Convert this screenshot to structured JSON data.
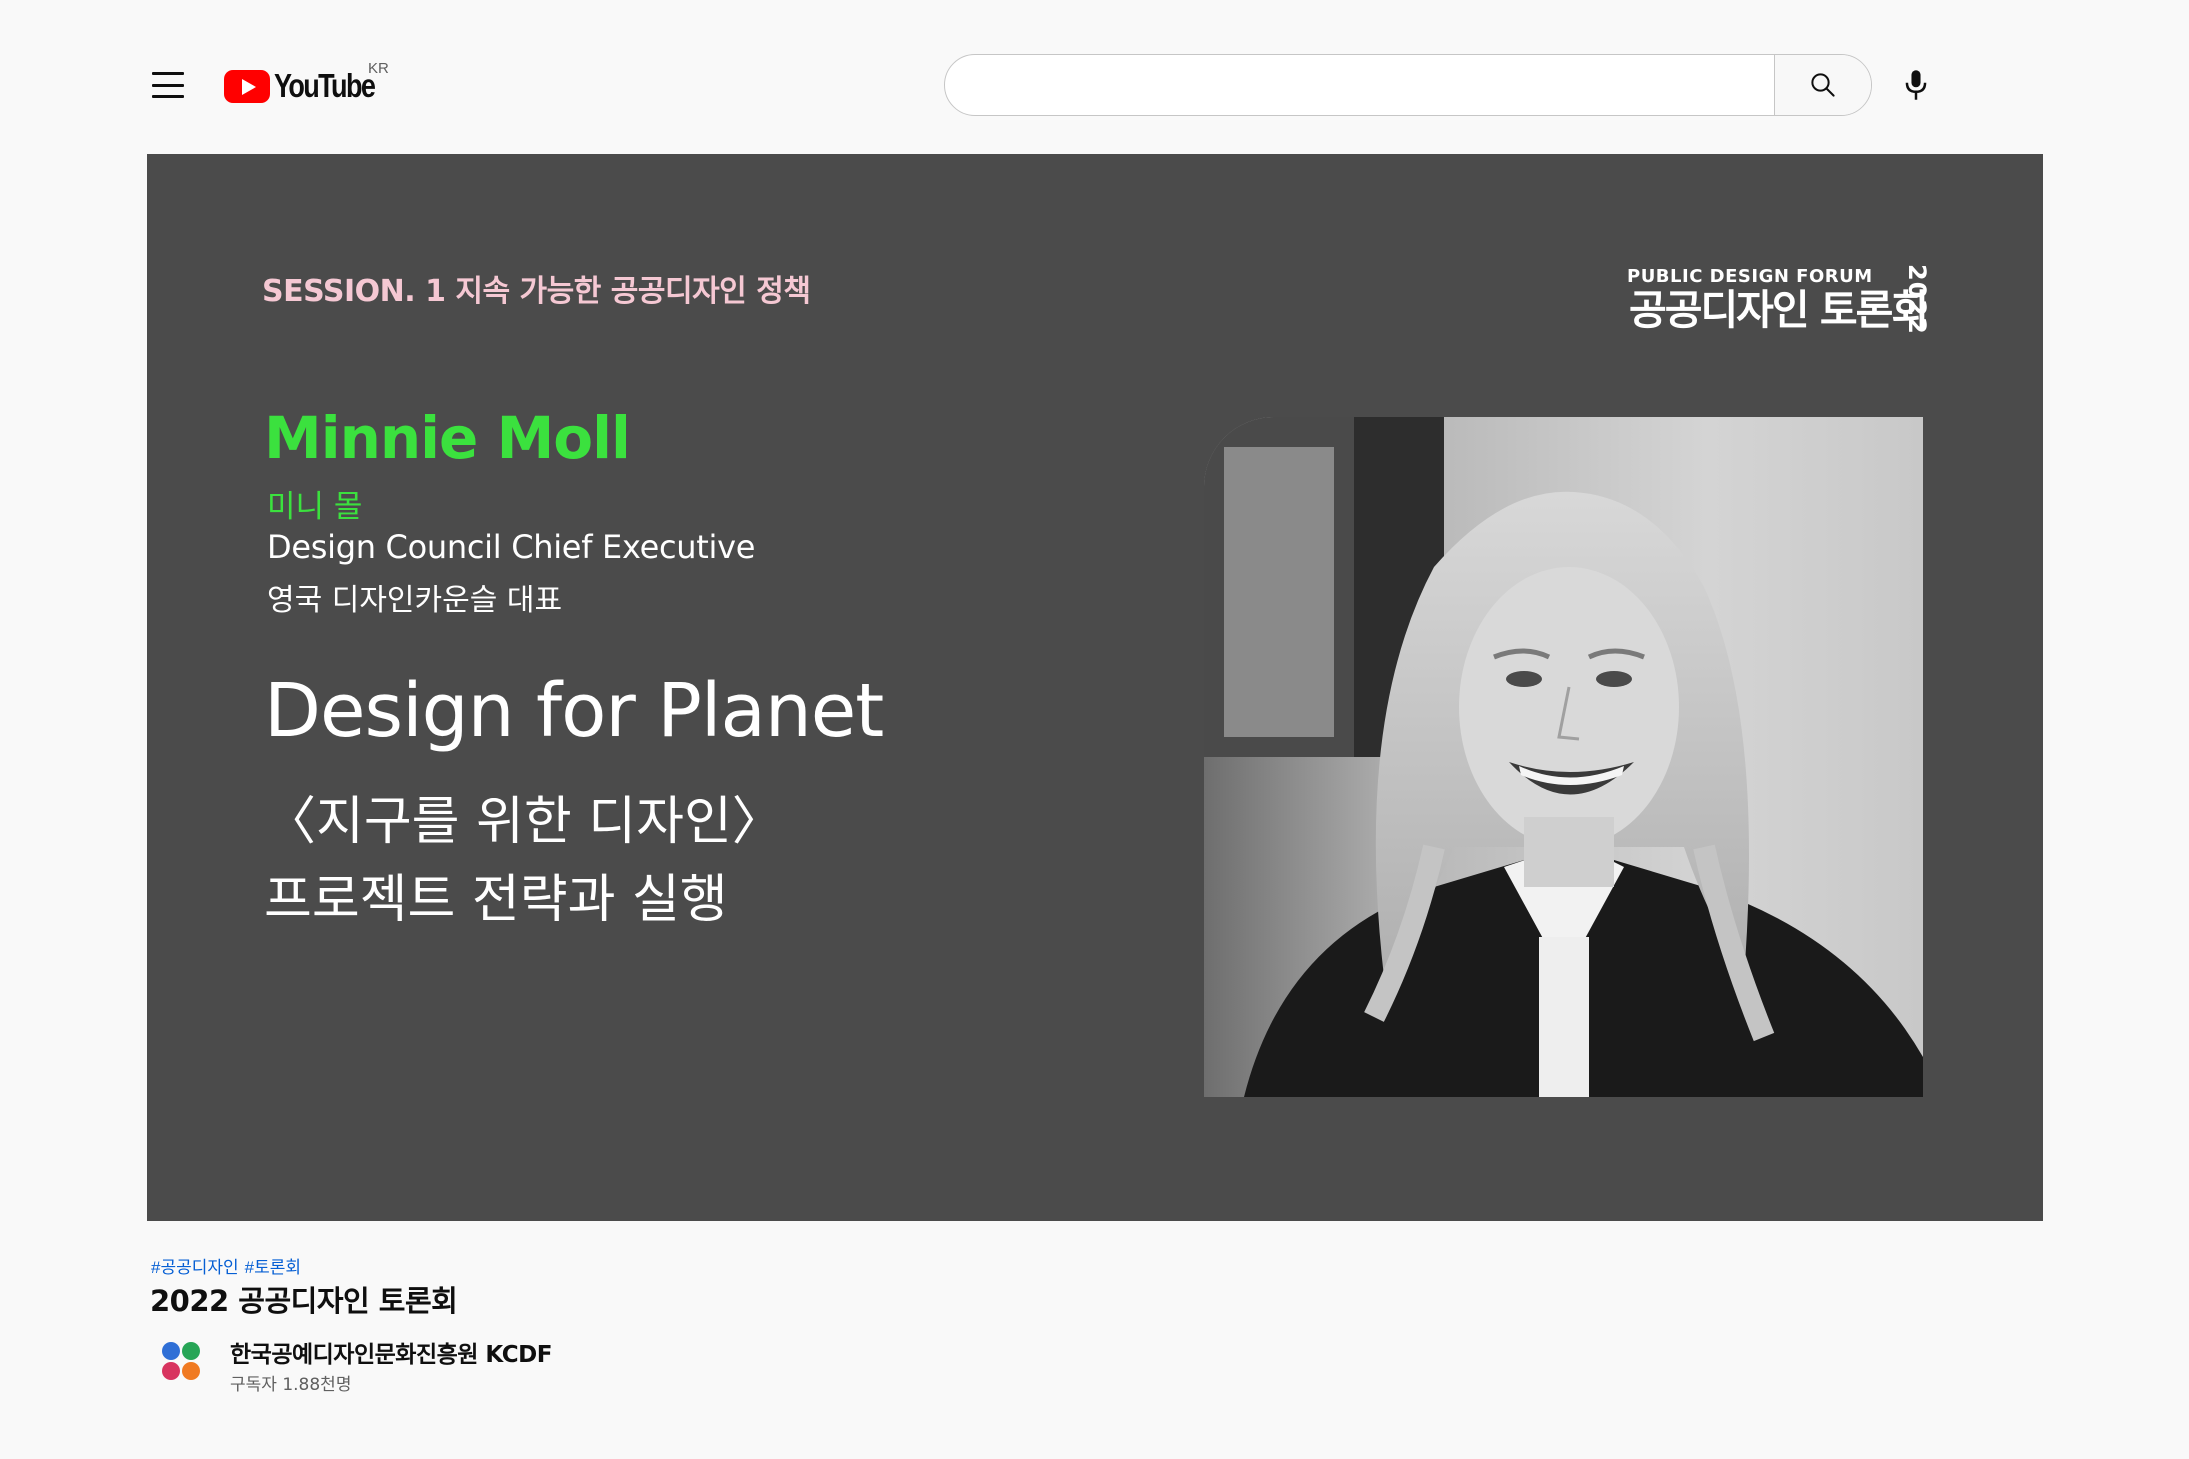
{
  "header": {
    "logo_text": "YouTube",
    "country_code": "KR",
    "search_placeholder": "",
    "search_value": ""
  },
  "video": {
    "session_label": "SESSION. 1  지속 가능한 공공디자인 정책",
    "forum": {
      "english": "PUBLIC DESIGN  FORUM",
      "korean": "공공디자인 토론회",
      "year": "2022"
    },
    "speaker": {
      "name_en": "Minnie Moll",
      "name_ko": "미니 몰",
      "role_en": "Design Council Chief Executive",
      "role_ko": "영국 디자인카운슬 대표"
    },
    "talk": {
      "title_en": "Design for Planet",
      "title_ko_line1": "〈지구를 위한 디자인〉",
      "title_ko_line2": "프로젝트 전략과 실행"
    }
  },
  "details": {
    "hashtags": [
      "#공공디자인",
      "#토론회"
    ],
    "title": "2022 공공디자인 토론회",
    "channel_name": "한국공예디자인문화진흥원 KCDF",
    "subscribers": "구독자 1.88천명"
  },
  "colors": {
    "brand_red": "#ff0000",
    "video_background": "#4b4b4b",
    "speaker_green": "#3be13e",
    "session_pink": "#f5c8d3",
    "hashtag_blue": "#065fd4"
  },
  "icons": [
    "menu-icon",
    "youtube-logo",
    "search-icon",
    "mic-icon",
    "channel-avatar"
  ]
}
